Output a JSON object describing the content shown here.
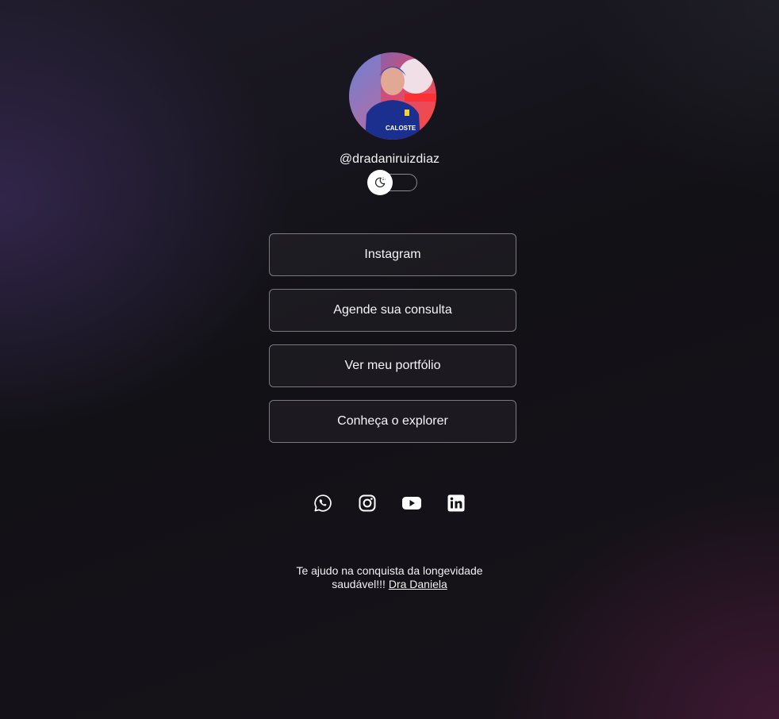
{
  "profile": {
    "username": "@dradaniruizdiaz",
    "avatar_label": "profile photo"
  },
  "theme_toggle": {
    "icon": "moon-sun-icon"
  },
  "links": [
    {
      "label": "Instagram"
    },
    {
      "label": "Agende sua consulta"
    },
    {
      "label": "Ver meu portfólio"
    },
    {
      "label": "Conheça o explorer"
    }
  ],
  "socials": [
    {
      "icon": "whatsapp-icon"
    },
    {
      "icon": "instagram-icon"
    },
    {
      "icon": "youtube-icon"
    },
    {
      "icon": "linkedin-icon"
    }
  ],
  "footer": {
    "line1": "Te ajudo na conquista da longevidade",
    "line2": "saudável!!!",
    "link_text": "Dra Daniela"
  },
  "colors": {
    "background": "#131217",
    "button_border": "#7b7a82",
    "text": "#f5f5f5"
  }
}
